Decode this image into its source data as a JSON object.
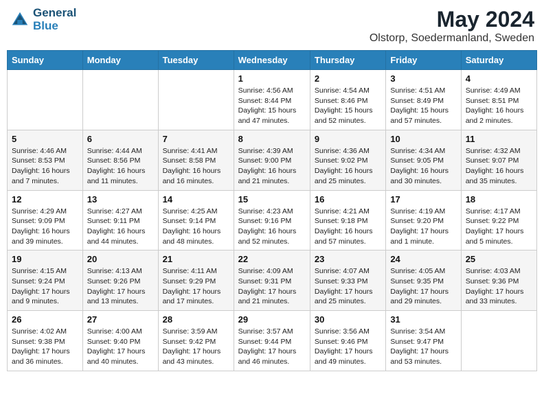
{
  "header": {
    "logo_line1": "General",
    "logo_line2": "Blue",
    "month": "May 2024",
    "location": "Olstorp, Soedermanland, Sweden"
  },
  "days_of_week": [
    "Sunday",
    "Monday",
    "Tuesday",
    "Wednesday",
    "Thursday",
    "Friday",
    "Saturday"
  ],
  "weeks": [
    [
      {
        "day": "",
        "info": ""
      },
      {
        "day": "",
        "info": ""
      },
      {
        "day": "",
        "info": ""
      },
      {
        "day": "1",
        "info": "Sunrise: 4:56 AM\nSunset: 8:44 PM\nDaylight: 15 hours and 47 minutes."
      },
      {
        "day": "2",
        "info": "Sunrise: 4:54 AM\nSunset: 8:46 PM\nDaylight: 15 hours and 52 minutes."
      },
      {
        "day": "3",
        "info": "Sunrise: 4:51 AM\nSunset: 8:49 PM\nDaylight: 15 hours and 57 minutes."
      },
      {
        "day": "4",
        "info": "Sunrise: 4:49 AM\nSunset: 8:51 PM\nDaylight: 16 hours and 2 minutes."
      }
    ],
    [
      {
        "day": "5",
        "info": "Sunrise: 4:46 AM\nSunset: 8:53 PM\nDaylight: 16 hours and 7 minutes."
      },
      {
        "day": "6",
        "info": "Sunrise: 4:44 AM\nSunset: 8:56 PM\nDaylight: 16 hours and 11 minutes."
      },
      {
        "day": "7",
        "info": "Sunrise: 4:41 AM\nSunset: 8:58 PM\nDaylight: 16 hours and 16 minutes."
      },
      {
        "day": "8",
        "info": "Sunrise: 4:39 AM\nSunset: 9:00 PM\nDaylight: 16 hours and 21 minutes."
      },
      {
        "day": "9",
        "info": "Sunrise: 4:36 AM\nSunset: 9:02 PM\nDaylight: 16 hours and 25 minutes."
      },
      {
        "day": "10",
        "info": "Sunrise: 4:34 AM\nSunset: 9:05 PM\nDaylight: 16 hours and 30 minutes."
      },
      {
        "day": "11",
        "info": "Sunrise: 4:32 AM\nSunset: 9:07 PM\nDaylight: 16 hours and 35 minutes."
      }
    ],
    [
      {
        "day": "12",
        "info": "Sunrise: 4:29 AM\nSunset: 9:09 PM\nDaylight: 16 hours and 39 minutes."
      },
      {
        "day": "13",
        "info": "Sunrise: 4:27 AM\nSunset: 9:11 PM\nDaylight: 16 hours and 44 minutes."
      },
      {
        "day": "14",
        "info": "Sunrise: 4:25 AM\nSunset: 9:14 PM\nDaylight: 16 hours and 48 minutes."
      },
      {
        "day": "15",
        "info": "Sunrise: 4:23 AM\nSunset: 9:16 PM\nDaylight: 16 hours and 52 minutes."
      },
      {
        "day": "16",
        "info": "Sunrise: 4:21 AM\nSunset: 9:18 PM\nDaylight: 16 hours and 57 minutes."
      },
      {
        "day": "17",
        "info": "Sunrise: 4:19 AM\nSunset: 9:20 PM\nDaylight: 17 hours and 1 minute."
      },
      {
        "day": "18",
        "info": "Sunrise: 4:17 AM\nSunset: 9:22 PM\nDaylight: 17 hours and 5 minutes."
      }
    ],
    [
      {
        "day": "19",
        "info": "Sunrise: 4:15 AM\nSunset: 9:24 PM\nDaylight: 17 hours and 9 minutes."
      },
      {
        "day": "20",
        "info": "Sunrise: 4:13 AM\nSunset: 9:26 PM\nDaylight: 17 hours and 13 minutes."
      },
      {
        "day": "21",
        "info": "Sunrise: 4:11 AM\nSunset: 9:29 PM\nDaylight: 17 hours and 17 minutes."
      },
      {
        "day": "22",
        "info": "Sunrise: 4:09 AM\nSunset: 9:31 PM\nDaylight: 17 hours and 21 minutes."
      },
      {
        "day": "23",
        "info": "Sunrise: 4:07 AM\nSunset: 9:33 PM\nDaylight: 17 hours and 25 minutes."
      },
      {
        "day": "24",
        "info": "Sunrise: 4:05 AM\nSunset: 9:35 PM\nDaylight: 17 hours and 29 minutes."
      },
      {
        "day": "25",
        "info": "Sunrise: 4:03 AM\nSunset: 9:36 PM\nDaylight: 17 hours and 33 minutes."
      }
    ],
    [
      {
        "day": "26",
        "info": "Sunrise: 4:02 AM\nSunset: 9:38 PM\nDaylight: 17 hours and 36 minutes."
      },
      {
        "day": "27",
        "info": "Sunrise: 4:00 AM\nSunset: 9:40 PM\nDaylight: 17 hours and 40 minutes."
      },
      {
        "day": "28",
        "info": "Sunrise: 3:59 AM\nSunset: 9:42 PM\nDaylight: 17 hours and 43 minutes."
      },
      {
        "day": "29",
        "info": "Sunrise: 3:57 AM\nSunset: 9:44 PM\nDaylight: 17 hours and 46 minutes."
      },
      {
        "day": "30",
        "info": "Sunrise: 3:56 AM\nSunset: 9:46 PM\nDaylight: 17 hours and 49 minutes."
      },
      {
        "day": "31",
        "info": "Sunrise: 3:54 AM\nSunset: 9:47 PM\nDaylight: 17 hours and 53 minutes."
      },
      {
        "day": "",
        "info": ""
      }
    ]
  ]
}
